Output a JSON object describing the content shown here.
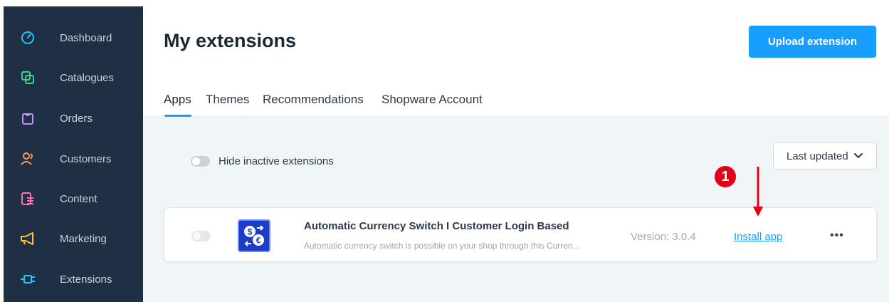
{
  "sidebar": {
    "items": [
      {
        "label": "Dashboard",
        "icon": "gauge-icon",
        "color": "#1ec7ff"
      },
      {
        "label": "Catalogues",
        "icon": "layers-icon",
        "color": "#3fd48a"
      },
      {
        "label": "Orders",
        "icon": "shopping-bag-icon",
        "color": "#c48cff"
      },
      {
        "label": "Customers",
        "icon": "users-icon",
        "color": "#ff9b5a"
      },
      {
        "label": "Content",
        "icon": "content-icon",
        "color": "#ff6fb5"
      },
      {
        "label": "Marketing",
        "icon": "megaphone-icon",
        "color": "#ffc628"
      },
      {
        "label": "Extensions",
        "icon": "plug-icon",
        "color": "#1ec7ff"
      }
    ]
  },
  "header": {
    "title": "My extensions",
    "upload_label": "Upload extension"
  },
  "tabs": [
    {
      "label": "Apps",
      "active": true
    },
    {
      "label": "Themes",
      "active": false
    },
    {
      "label": "Recommendations",
      "active": false
    },
    {
      "label": "Shopware Account",
      "active": false
    }
  ],
  "filters": {
    "hide_inactive_label": "Hide inactive extensions",
    "sort_label": "Last updated"
  },
  "extension": {
    "name": "Automatic Currency Switch I Customer Login Based",
    "description": "Automatic currency switch is possible on your shop through this Curren…",
    "version": "Version: 3.0.4",
    "install_label": "Install app",
    "more_label": "•••"
  },
  "annotation": {
    "number": "1",
    "color": "#e40016"
  },
  "colors": {
    "accent": "#189eff",
    "sidebar_bg": "#1f3044"
  }
}
